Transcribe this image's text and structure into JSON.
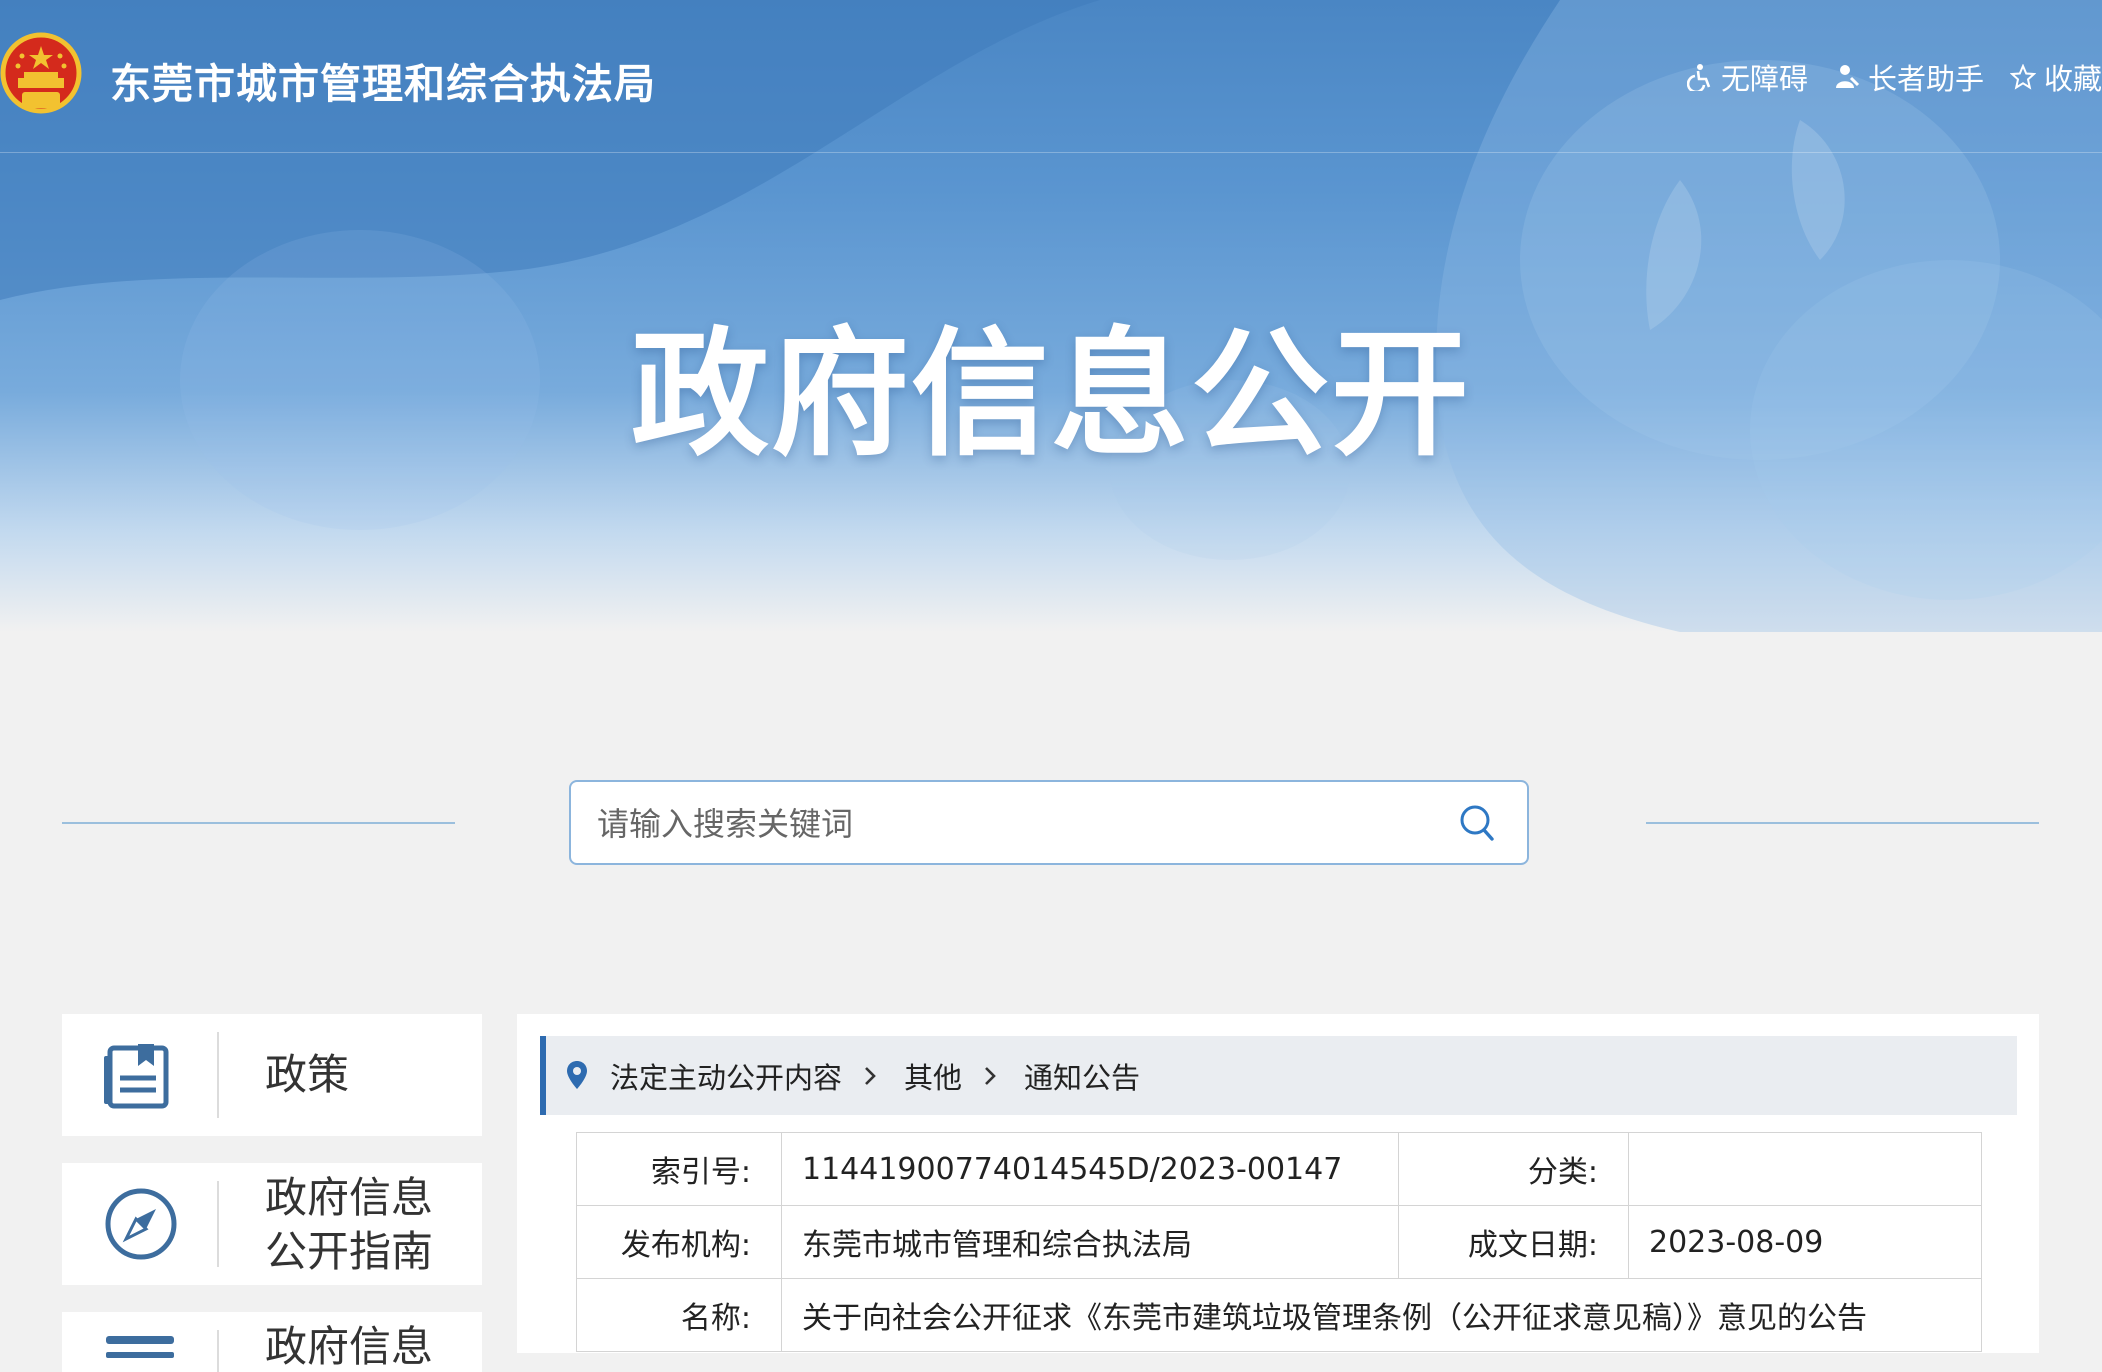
{
  "header": {
    "site_title": "东莞市城市管理和综合执法局",
    "tools": [
      {
        "icon": "wheelchair-icon",
        "label": "无障碍"
      },
      {
        "icon": "elder-assist-icon",
        "label": "长者助手"
      },
      {
        "icon": "star-icon",
        "label": "收藏"
      }
    ]
  },
  "banner": {
    "title": "政府信息公开"
  },
  "search": {
    "placeholder": "请输入搜索关键词",
    "value": ""
  },
  "sidebar": {
    "items": [
      {
        "icon": "policy-document-icon",
        "label": "政策"
      },
      {
        "icon": "compass-icon",
        "label": "政府信息公开指南"
      },
      {
        "icon": "info-list-icon",
        "label": "政府信息"
      }
    ]
  },
  "breadcrumb": {
    "icon": "location-pin-icon",
    "items": [
      "法定主动公开内容",
      "其他",
      "通知公告"
    ]
  },
  "meta": {
    "index_label": "索引号:",
    "index_value": "11441900774014545D/2023-00147",
    "category_label": "分类:",
    "category_value": "",
    "publisher_label": "发布机构:",
    "publisher_value": "东莞市城市管理和综合执法局",
    "date_label": "成文日期:",
    "date_value": "2023-08-09",
    "name_label": "名称:",
    "name_value": "关于向社会公开征求《东莞市建筑垃圾管理条例（公开征求意见稿）》意见的公告"
  },
  "colors": {
    "banner_blue": "#4a86c4",
    "accent_blue": "#2e6bb0",
    "icon_blue": "#3d6d9e",
    "page_bg": "#f1f1f1"
  }
}
